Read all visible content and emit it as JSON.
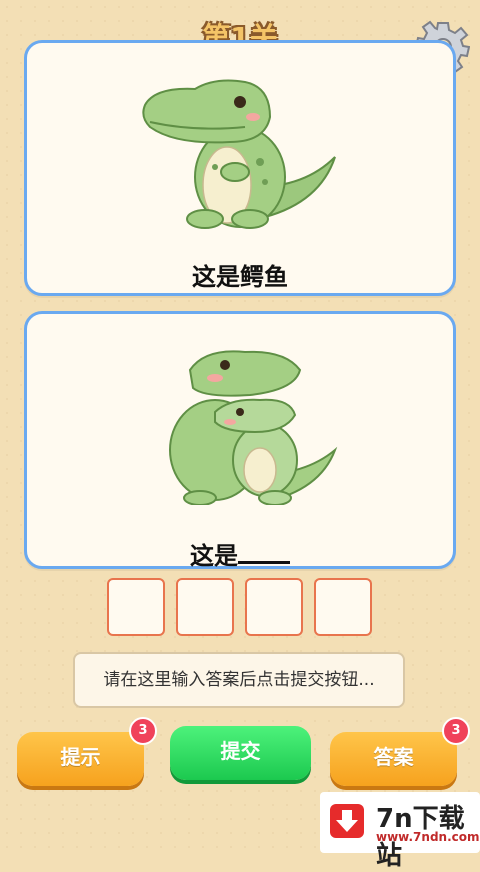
{
  "header": {
    "level_title": "第1关"
  },
  "cards": [
    {
      "image": "crocodile-single",
      "text": "这是鳄鱼"
    },
    {
      "image": "crocodile-pair",
      "text_prefix": "这是"
    }
  ],
  "answer_slots": 4,
  "input": {
    "placeholder": "请在这里输入答案后点击提交按钮..."
  },
  "buttons": {
    "hint": {
      "label": "提示",
      "badge": "3"
    },
    "submit": {
      "label": "提交"
    },
    "answer": {
      "label": "答案",
      "badge": "3"
    }
  },
  "watermark": {
    "text": "7n下载站",
    "url": "www.7ndn.com"
  },
  "colors": {
    "card_border": "#6aa9f0",
    "slot_border": "#e8744d",
    "hint_button": "#f6a21e",
    "submit_button": "#1cc94f",
    "badge": "#f0425a"
  }
}
